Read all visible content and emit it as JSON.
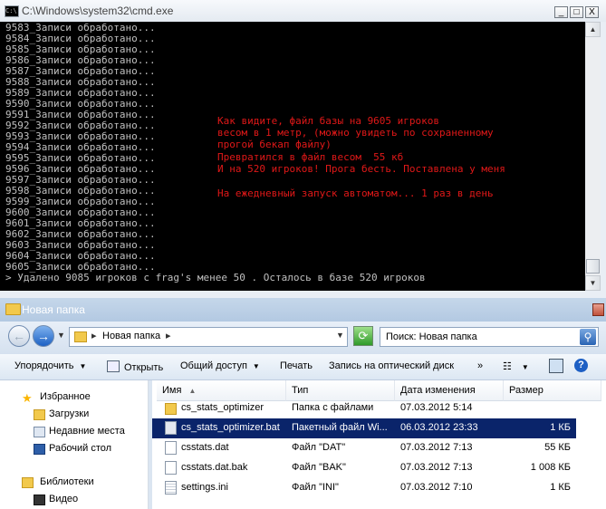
{
  "cmd": {
    "title": "C:\\Windows\\system32\\cmd.exe",
    "icon_text": "C:\\",
    "buttons": {
      "minimize": "_",
      "maximize": "□",
      "close": "X"
    },
    "lines": [
      "9583_Записи обработано...",
      "9584_Записи обработано...",
      "9585_Записи обработано...",
      "9586_Записи обработано...",
      "9587_Записи обработано...",
      "9588_Записи обработано...",
      "9589_Записи обработано...",
      "9590_Записи обработано...",
      "9591_Записи обработано...",
      "9592_Записи обработано...",
      "9593_Записи обработано...",
      "9594_Записи обработано...",
      "9595_Записи обработано...",
      "9596_Записи обработано...",
      "9597_Записи обработано...",
      "9598_Записи обработано...",
      "9599_Записи обработано...",
      "9600_Записи обработано...",
      "9601_Записи обработано...",
      "9602_Записи обработано...",
      "9603_Записи обработано...",
      "9604_Записи обработано...",
      "9605_Записи обработано...",
      "> Удалено 9085 игроков с frag's менее 50 . Осталось в базе 520 игроков"
    ],
    "annotation": [
      "Как видите, файл базы на 9605 игроков",
      "весом в 1 метр, (можно увидеть по сохраненному",
      "прогой бекап файлу)",
      "Превратился в файл весом  55 кб",
      "И на 520 игроков! Прога бесть. Поставлена у меня",
      "",
      "На ежедневный запуск автоматом... 1 раз в день"
    ],
    "annotation_color": "#e01818"
  },
  "explorer": {
    "title": "Новая папка",
    "address": "Новая папка",
    "search_placeholder": "Поиск: Новая папка",
    "toolbar": {
      "organize": "Упорядочить",
      "open": "Открыть",
      "share": "Общий доступ",
      "print": "Печать",
      "burn": "Запись на оптический диск",
      "more": "»"
    },
    "nav": {
      "favorites": "Избранное",
      "downloads": "Загрузки",
      "recent": "Недавние места",
      "desktop": "Рабочий стол",
      "libraries": "Библиотеки",
      "video": "Видео"
    },
    "columns": {
      "name": "Имя",
      "type": "Тип",
      "date": "Дата изменения",
      "size": "Размер"
    },
    "files": [
      {
        "name": "cs_stats_optimizer",
        "type": "Папка с файлами",
        "date": "07.03.2012 5:14",
        "size": "",
        "icon": "folder-icon"
      },
      {
        "name": "cs_stats_optimizer.bat",
        "type": "Пакетный файл Wi...",
        "date": "06.03.2012 23:33",
        "size": "1 КБ",
        "icon": "batch-file-icon"
      },
      {
        "name": "csstats.dat",
        "type": "Файл \"DAT\"",
        "date": "07.03.2012 7:13",
        "size": "55 КБ",
        "icon": "file-icon"
      },
      {
        "name": "csstats.dat.bak",
        "type": "Файл \"BAK\"",
        "date": "07.03.2012 7:13",
        "size": "1 008 КБ",
        "icon": "file-icon"
      },
      {
        "name": "settings.ini",
        "type": "Файл \"INI\"",
        "date": "07.03.2012 7:10",
        "size": "1 КБ",
        "icon": "ini-file-icon"
      }
    ]
  }
}
